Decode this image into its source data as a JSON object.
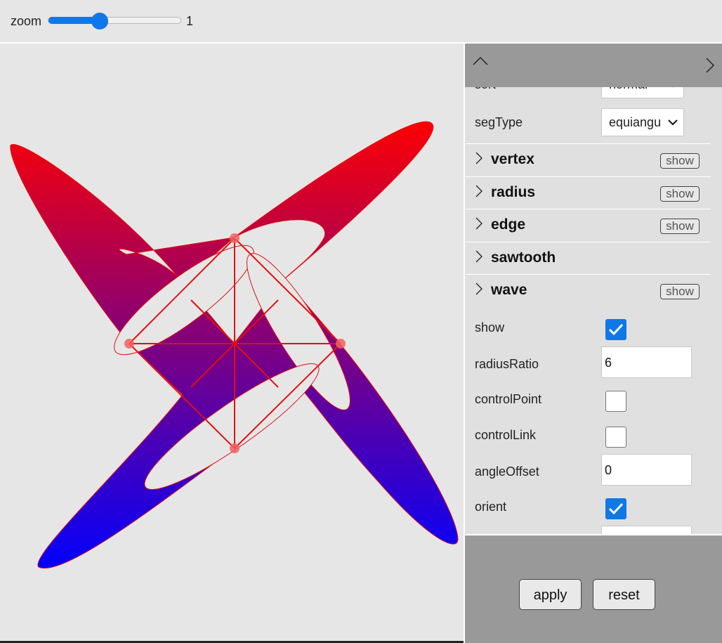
{
  "zoom": {
    "label": "zoom",
    "value": "1",
    "slider_fraction": 0.39
  },
  "panel": {
    "partial_row": {
      "label": "sort",
      "value": "normal"
    },
    "segType": {
      "label": "segType",
      "value": "equiangu"
    },
    "sections": [
      {
        "title": "vertex",
        "button": "show"
      },
      {
        "title": "radius",
        "button": "show"
      },
      {
        "title": "edge",
        "button": "show"
      },
      {
        "title": "sawtooth",
        "button": ""
      },
      {
        "title": "wave",
        "button": "show"
      }
    ],
    "wave_fields": {
      "show": {
        "label": "show",
        "checked": true
      },
      "radiusRatio": {
        "label": "radiusRatio",
        "value": "6"
      },
      "controlPoint": {
        "label": "controlPoint",
        "checked": false
      },
      "controlLink": {
        "label": "controlLink",
        "checked": false
      },
      "angleOffset": {
        "label": "angleOffset",
        "value": "0"
      },
      "orient": {
        "label": "orient",
        "checked": true
      }
    }
  },
  "footer": {
    "apply_label": "apply",
    "reset_label": "reset"
  },
  "colors": {
    "accent": "#0f78e8",
    "gradient_top": "#ff0000",
    "gradient_bottom": "#0000ff",
    "vertex_point": "#f26060",
    "stroke": "#e01010",
    "panel_header": "#999999"
  },
  "icons": {
    "collapse": "chevron-up-icon",
    "next": "chevron-right-icon",
    "section": "chevron-right-icon",
    "check": "checkmark-icon",
    "dropdown": "chevron-down-icon"
  }
}
